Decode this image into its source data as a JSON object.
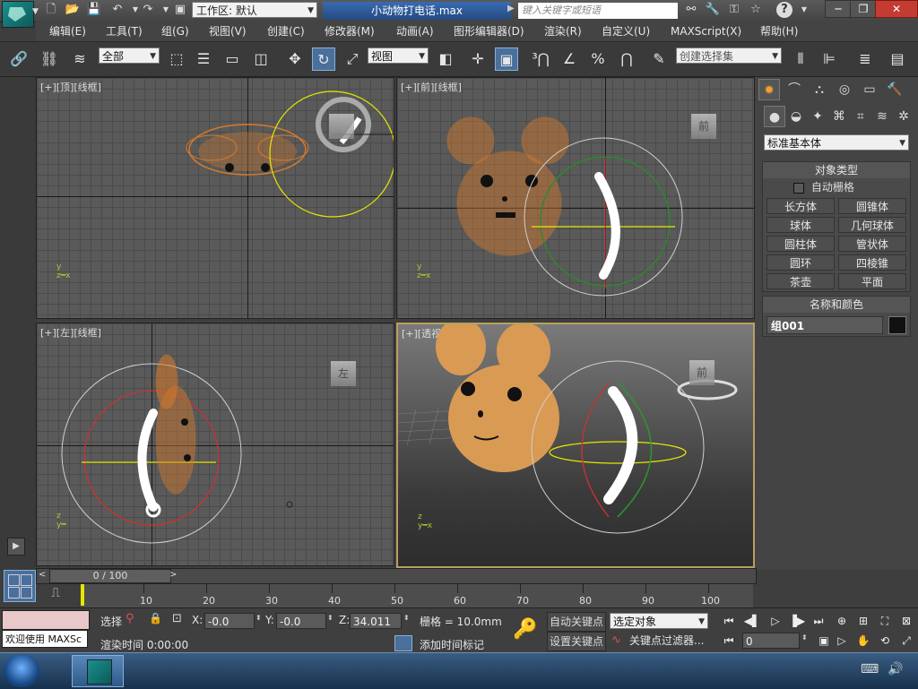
{
  "titlebar": {
    "workspace_label": "工作区: 默认",
    "filename": "小动物打电话.max",
    "search_placeholder": "键入关键字或短语",
    "min": "─",
    "restore": "❐",
    "close": "✕"
  },
  "menu": [
    "编辑(E)",
    "工具(T)",
    "组(G)",
    "视图(V)",
    "创建(C)",
    "修改器(M)",
    "动画(A)",
    "图形编辑器(D)",
    "渲染(R)",
    "自定义(U)",
    "MAXScript(X)",
    "帮助(H)"
  ],
  "toolbar": {
    "selection_filter": "全部",
    "ref_coord": "视图",
    "named_selection": "创建选择集"
  },
  "viewports": {
    "top": "[+][顶][线框]",
    "front": "[+][前][线框]",
    "left": "[+][左][线框]",
    "persp": "[+][透视][真实]",
    "cube_top": "",
    "cube_front": "前",
    "cube_left": "左",
    "cube_persp": "前"
  },
  "command_panel": {
    "category": "标准基本体",
    "object_type_title": "对象类型",
    "autogrid": "自动栅格",
    "buttons": [
      "长方体",
      "圆锥体",
      "球体",
      "几何球体",
      "圆柱体",
      "管状体",
      "圆环",
      "四棱锥",
      "茶壶",
      "平面"
    ],
    "name_color_title": "名称和颜色",
    "object_name": "组001",
    "object_color": "#111111"
  },
  "timeline": {
    "frame_label": "0 / 100",
    "ticks": [
      "10",
      "20",
      "30",
      "40",
      "50",
      "60",
      "70",
      "80",
      "90",
      "100"
    ]
  },
  "status": {
    "maxscript_text": "欢迎使用 MAXSc",
    "selection_label": "选择",
    "x_label": "X:",
    "x_value": "-0.0",
    "y_label": "Y:",
    "y_value": "-0.0",
    "z_label": "Z:",
    "z_value": "34.011",
    "grid_label": "栅格 = 10.0mm",
    "render_time": "渲染时间  0:00:00",
    "add_time_tag": "添加时间标记",
    "auto_key": "自动关键点",
    "set_key": "设置关键点",
    "selected_set": "选定对象",
    "key_filters": "关键点过滤器...",
    "current_frame": "0"
  },
  "colors": {
    "accent": "#4a6f9a",
    "orange_object": "#d87a2a",
    "persp_border": "#b8a060"
  }
}
